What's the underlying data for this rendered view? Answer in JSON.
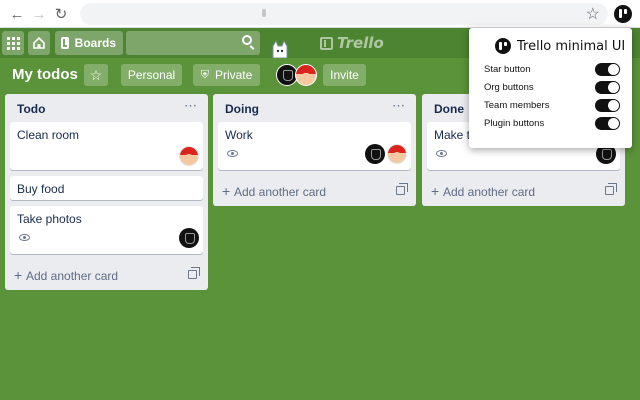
{
  "browser": {
    "back_icon": "arrow-left-icon",
    "forward_icon": "arrow-right-icon",
    "reload_icon": "reload-icon",
    "bookmark_icon": "star-icon",
    "extension_icon": "trello-extension-icon"
  },
  "header": {
    "apps_icon": "grid-icon",
    "home_icon": "home-icon",
    "boards_label": "Boards",
    "search_placeholder": "",
    "logo_text": "Trello"
  },
  "board": {
    "title": "My todos",
    "team_label": "Personal",
    "visibility_label": "Private",
    "invite_label": "Invite"
  },
  "lists": [
    {
      "title": "Todo",
      "cards": [
        {
          "title": "Clean room",
          "watching": false,
          "members": [
            "mario"
          ]
        },
        {
          "title": "Buy food",
          "watching": false,
          "members": []
        },
        {
          "title": "Take photos",
          "watching": true,
          "members": [
            "dark"
          ]
        }
      ],
      "add_label": "Add another card"
    },
    {
      "title": "Doing",
      "cards": [
        {
          "title": "Work",
          "watching": true,
          "members": [
            "dark",
            "mario"
          ]
        }
      ],
      "add_label": "Add another card"
    },
    {
      "title": "Done",
      "cards": [
        {
          "title": "Make te",
          "watching": true,
          "members": [
            "dark"
          ]
        }
      ],
      "add_label": "Add another card"
    }
  ],
  "popup": {
    "title": "Trello minimal UI",
    "options": [
      {
        "label": "Star button",
        "enabled": true
      },
      {
        "label": "Org buttons",
        "enabled": true
      },
      {
        "label": "Team members",
        "enabled": true
      },
      {
        "label": "Plugin buttons",
        "enabled": true
      }
    ]
  },
  "colors": {
    "board_background": "#5a9339",
    "header_background": "#4d8431",
    "list_background": "#ebecf0",
    "toggle_on": "#111111"
  }
}
